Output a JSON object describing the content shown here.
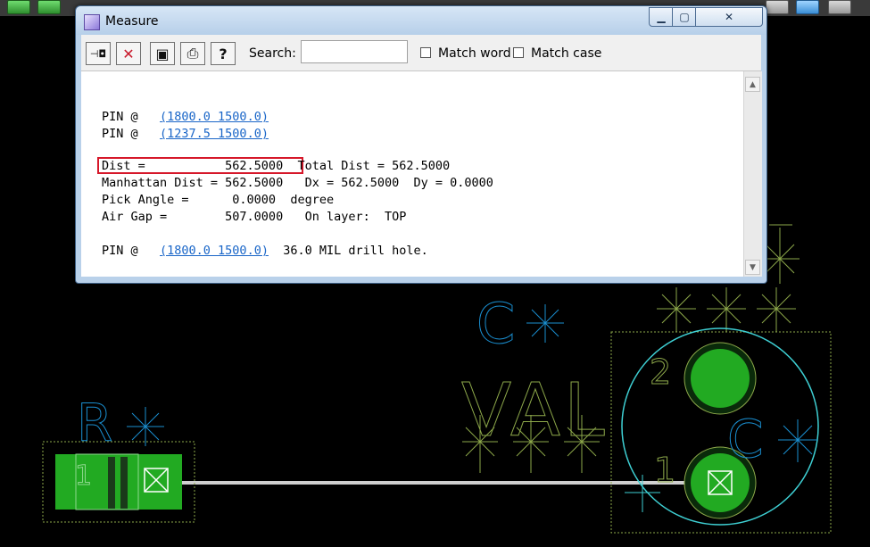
{
  "window": {
    "title": "Measure"
  },
  "toolbar": {
    "buttons": [
      {
        "name": "pin",
        "glyph": "⊣◘"
      },
      {
        "name": "cancel",
        "glyph": "✕"
      },
      {
        "name": "save",
        "glyph": "▣"
      },
      {
        "name": "print",
        "glyph": "⎙"
      },
      {
        "name": "help",
        "glyph": "?"
      }
    ],
    "search_label": "Search:",
    "search_value": "",
    "match_word_label": "Match word",
    "match_case_label": "Match case"
  },
  "output": {
    "pin1_prefix": "PIN @",
    "pin1_link": "(1800.0 1500.0)",
    "pin2_prefix": "PIN @",
    "pin2_link": "(1237.5 1500.0)",
    "dist_line": "Dist =           562.5000",
    "total_dist": "  Total Dist = 562.5000",
    "manhattan_line": "Manhattan Dist = 562.5000   Dx = 562.5000  Dy = 0.0000",
    "pick_angle_line": "Pick Angle =      0.0000  degree",
    "air_gap_line": "Air Gap =        507.0000   On layer:  TOP",
    "pin3_prefix": "PIN @",
    "pin3_link": "(1800.0 1500.0)",
    "pin3_suffix": "  36.0 MIL drill hole."
  },
  "pcb": {
    "labels": {
      "r": "R",
      "c_top": "C",
      "val": "VAL",
      "c_right": "C",
      "pin2": "2",
      "pin1_right": "1",
      "pin1_left": "1"
    },
    "colors": {
      "background": "#000000",
      "pad_green": "#22aa22",
      "silk_blue": "#1a8fd1",
      "silk_yellow": "#8da84a",
      "cyan": "#3ecfd3",
      "trace": "#cfcfcf"
    }
  }
}
